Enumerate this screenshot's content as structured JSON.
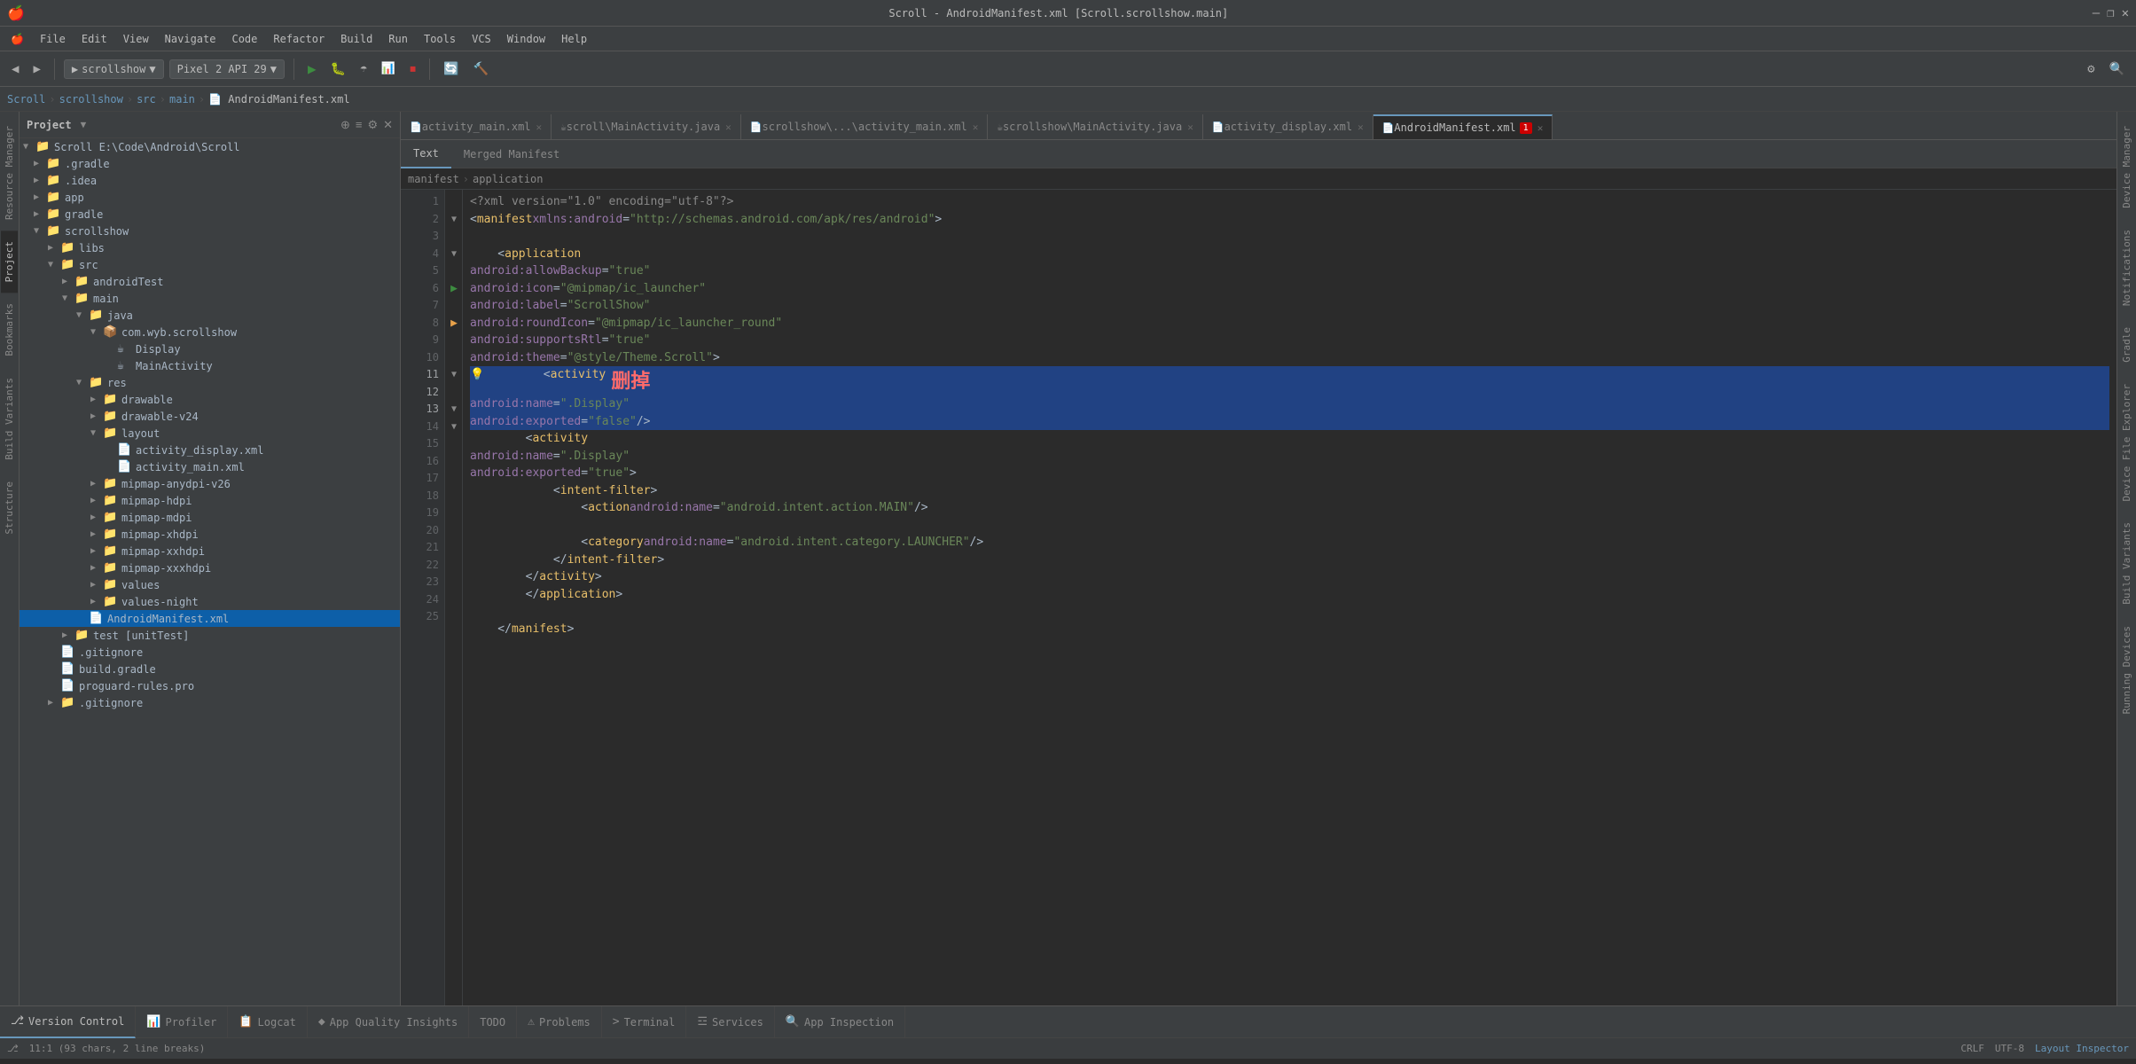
{
  "titleBar": {
    "title": "Scroll - AndroidManifest.xml [Scroll.scrollshow.main]",
    "minimize": "—",
    "maximize": "❐",
    "close": "✕"
  },
  "menuBar": {
    "items": [
      "🍎",
      "File",
      "Edit",
      "View",
      "Navigate",
      "Code",
      "Refactor",
      "Build",
      "Run",
      "Tools",
      "VCS",
      "Window",
      "Help"
    ]
  },
  "breadcrumb": {
    "items": [
      "Scroll",
      "scrollshow",
      "src",
      "main",
      "AndroidManifest.xml"
    ]
  },
  "tabs": [
    {
      "label": "activity_main.xml",
      "active": false,
      "modified": false
    },
    {
      "label": "scroll\\MainActivity.java",
      "active": false,
      "modified": false
    },
    {
      "label": "scrollshow\\...\\activity_main.xml",
      "active": false,
      "modified": false
    },
    {
      "label": "scrollshow\\MainActivity.java",
      "active": false,
      "modified": false
    },
    {
      "label": "activity_display.xml",
      "active": false,
      "modified": false
    },
    {
      "label": "AndroidManifest.xml",
      "active": true,
      "modified": false
    }
  ],
  "projectTree": {
    "items": [
      {
        "indent": 0,
        "arrow": "▼",
        "icon": "📁",
        "label": "Scroll E:\\Code\\Android\\Scroll",
        "type": "folder"
      },
      {
        "indent": 1,
        "arrow": "▶",
        "icon": "📁",
        "label": ".gradle",
        "type": "folder"
      },
      {
        "indent": 1,
        "arrow": "▶",
        "icon": "📁",
        "label": ".idea",
        "type": "folder"
      },
      {
        "indent": 1,
        "arrow": "▶",
        "icon": "📁",
        "label": "app",
        "type": "folder"
      },
      {
        "indent": 1,
        "arrow": "▶",
        "icon": "📁",
        "label": "gradle",
        "type": "folder"
      },
      {
        "indent": 1,
        "arrow": "▼",
        "icon": "📁",
        "label": "scrollshow",
        "type": "folder"
      },
      {
        "indent": 2,
        "arrow": "▶",
        "icon": "📁",
        "label": "libs",
        "type": "folder"
      },
      {
        "indent": 2,
        "arrow": "▼",
        "icon": "📁",
        "label": "src",
        "type": "folder"
      },
      {
        "indent": 3,
        "arrow": "▶",
        "icon": "📁",
        "label": "androidTest",
        "type": "folder"
      },
      {
        "indent": 3,
        "arrow": "▼",
        "icon": "📁",
        "label": "main",
        "type": "folder"
      },
      {
        "indent": 4,
        "arrow": "▼",
        "icon": "📁",
        "label": "java",
        "type": "folder"
      },
      {
        "indent": 5,
        "arrow": "▼",
        "icon": "📦",
        "label": "com.wyb.scrollshow",
        "type": "package"
      },
      {
        "indent": 6,
        "arrow": "",
        "icon": "☕",
        "label": "Display",
        "type": "java"
      },
      {
        "indent": 6,
        "arrow": "",
        "icon": "☕",
        "label": "MainActivity",
        "type": "java"
      },
      {
        "indent": 4,
        "arrow": "▼",
        "icon": "📁",
        "label": "res",
        "type": "folder"
      },
      {
        "indent": 5,
        "arrow": "▶",
        "icon": "📁",
        "label": "drawable",
        "type": "folder"
      },
      {
        "indent": 5,
        "arrow": "▶",
        "icon": "📁",
        "label": "drawable-v24",
        "type": "folder"
      },
      {
        "indent": 5,
        "arrow": "▼",
        "icon": "📁",
        "label": "layout",
        "type": "folder"
      },
      {
        "indent": 6,
        "arrow": "",
        "icon": "📄",
        "label": "activity_display.xml",
        "type": "xml"
      },
      {
        "indent": 6,
        "arrow": "",
        "icon": "📄",
        "label": "activity_main.xml",
        "type": "xml"
      },
      {
        "indent": 5,
        "arrow": "▶",
        "icon": "📁",
        "label": "mipmap-anydpi-v26",
        "type": "folder"
      },
      {
        "indent": 5,
        "arrow": "▶",
        "icon": "📁",
        "label": "mipmap-hdpi",
        "type": "folder"
      },
      {
        "indent": 5,
        "arrow": "▶",
        "icon": "📁",
        "label": "mipmap-mdpi",
        "type": "folder"
      },
      {
        "indent": 5,
        "arrow": "▶",
        "icon": "📁",
        "label": "mipmap-xhdpi",
        "type": "folder"
      },
      {
        "indent": 5,
        "arrow": "▶",
        "icon": "📁",
        "label": "mipmap-xxhdpi",
        "type": "folder"
      },
      {
        "indent": 5,
        "arrow": "▶",
        "icon": "📁",
        "label": "mipmap-xxxhdpi",
        "type": "folder"
      },
      {
        "indent": 5,
        "arrow": "▶",
        "icon": "📁",
        "label": "values",
        "type": "folder"
      },
      {
        "indent": 5,
        "arrow": "▶",
        "icon": "📁",
        "label": "values-night",
        "type": "folder"
      },
      {
        "indent": 4,
        "arrow": "",
        "icon": "📄",
        "label": "AndroidManifest.xml",
        "type": "xml",
        "selected": true
      },
      {
        "indent": 3,
        "arrow": "▶",
        "icon": "📁",
        "label": "test [unitTest]",
        "type": "folder"
      },
      {
        "indent": 2,
        "arrow": "",
        "icon": "📄",
        "label": ".gitignore",
        "type": "file"
      },
      {
        "indent": 2,
        "arrow": "",
        "icon": "📄",
        "label": "build.gradle",
        "type": "gradle"
      },
      {
        "indent": 2,
        "arrow": "",
        "icon": "📄",
        "label": "proguard-rules.pro",
        "type": "file"
      },
      {
        "indent": 2,
        "arrow": "▶",
        "icon": "📁",
        "label": ".gitignore",
        "type": "file"
      }
    ]
  },
  "codeLines": [
    {
      "num": 1,
      "content": "<?xml version=\"1.0\" encoding=\"utf-8\"?>",
      "gutter": ""
    },
    {
      "num": 2,
      "content": "<manifest xmlns:android=\"http://schemas.android.com/apk/res/android\">",
      "gutter": "fold"
    },
    {
      "num": 3,
      "content": "",
      "gutter": ""
    },
    {
      "num": 4,
      "content": "    <application",
      "gutter": "fold"
    },
    {
      "num": 5,
      "content": "        android:allowBackup=\"true\"",
      "gutter": ""
    },
    {
      "num": 6,
      "content": "        android:icon=\"@mipmap/ic_launcher\"",
      "gutter": "run"
    },
    {
      "num": 7,
      "content": "        android:label=\"ScrollShow\"",
      "gutter": ""
    },
    {
      "num": 8,
      "content": "        android:roundIcon=\"@mipmap/ic_launcher_round\"",
      "gutter": "run-orange"
    },
    {
      "num": 9,
      "content": "        android:supportsRtl=\"true\"",
      "gutter": ""
    },
    {
      "num": 10,
      "content": "        android:theme=\"@style/Theme.Scroll\">",
      "gutter": ""
    },
    {
      "num": 11,
      "content": "        <activity",
      "gutter": "fold",
      "selected": true
    },
    {
      "num": 12,
      "content": "            android:name=\".Display\"",
      "gutter": "",
      "selected": true
    },
    {
      "num": 13,
      "content": "            android:exported=\"false\" />",
      "gutter": "fold",
      "selected": true
    },
    {
      "num": 14,
      "content": "        <activity",
      "gutter": "fold"
    },
    {
      "num": 15,
      "content": "            android:name=\".Display\"",
      "gutter": ""
    },
    {
      "num": 16,
      "content": "            android:exported=\"true\">",
      "gutter": ""
    },
    {
      "num": 17,
      "content": "            <intent-filter>",
      "gutter": ""
    },
    {
      "num": 18,
      "content": "                <action android:name=\"android.intent.action.MAIN\" />",
      "gutter": ""
    },
    {
      "num": 19,
      "content": "",
      "gutter": ""
    },
    {
      "num": 20,
      "content": "                <category android:name=\"android.intent.category.LAUNCHER\" />",
      "gutter": ""
    },
    {
      "num": 21,
      "content": "            </intent-filter>",
      "gutter": ""
    },
    {
      "num": 22,
      "content": "        </activity>",
      "gutter": ""
    },
    {
      "num": 23,
      "content": "        </application>",
      "gutter": ""
    },
    {
      "num": 24,
      "content": "",
      "gutter": ""
    },
    {
      "num": 25,
      "content": "    </manifest>",
      "gutter": ""
    }
  ],
  "manifestTabs": [
    "Text",
    "Merged Manifest"
  ],
  "breadcrumb2": [
    "manifest",
    "application"
  ],
  "bottomTabs": [
    {
      "label": "Version Control",
      "icon": "⎇"
    },
    {
      "label": "Profiler",
      "icon": "📊"
    },
    {
      "label": "Logcat",
      "icon": "📋"
    },
    {
      "label": "App Quality Insights",
      "icon": "◆"
    },
    {
      "label": "TODO",
      "icon": ""
    },
    {
      "label": "Problems",
      "icon": "⚠"
    },
    {
      "label": "Terminal",
      "icon": ">"
    },
    {
      "label": "Services",
      "icon": "☲"
    },
    {
      "label": "App Inspection",
      "icon": "🔍"
    }
  ],
  "statusBar": {
    "left": "11:1 (93 chars, 2 line breaks)",
    "encoding": "CRLF",
    "fileType": "UTF-8",
    "right": "Layout Inspector"
  },
  "rightTabs": [
    "Device Manager",
    "Notifications",
    "Gradle",
    "Device File Explorer",
    "Build Variants",
    "Running Devices"
  ],
  "runConfig": "scrollshow",
  "device": "Pixel 2 API 29",
  "deletionText": "删掉",
  "errors": "1"
}
